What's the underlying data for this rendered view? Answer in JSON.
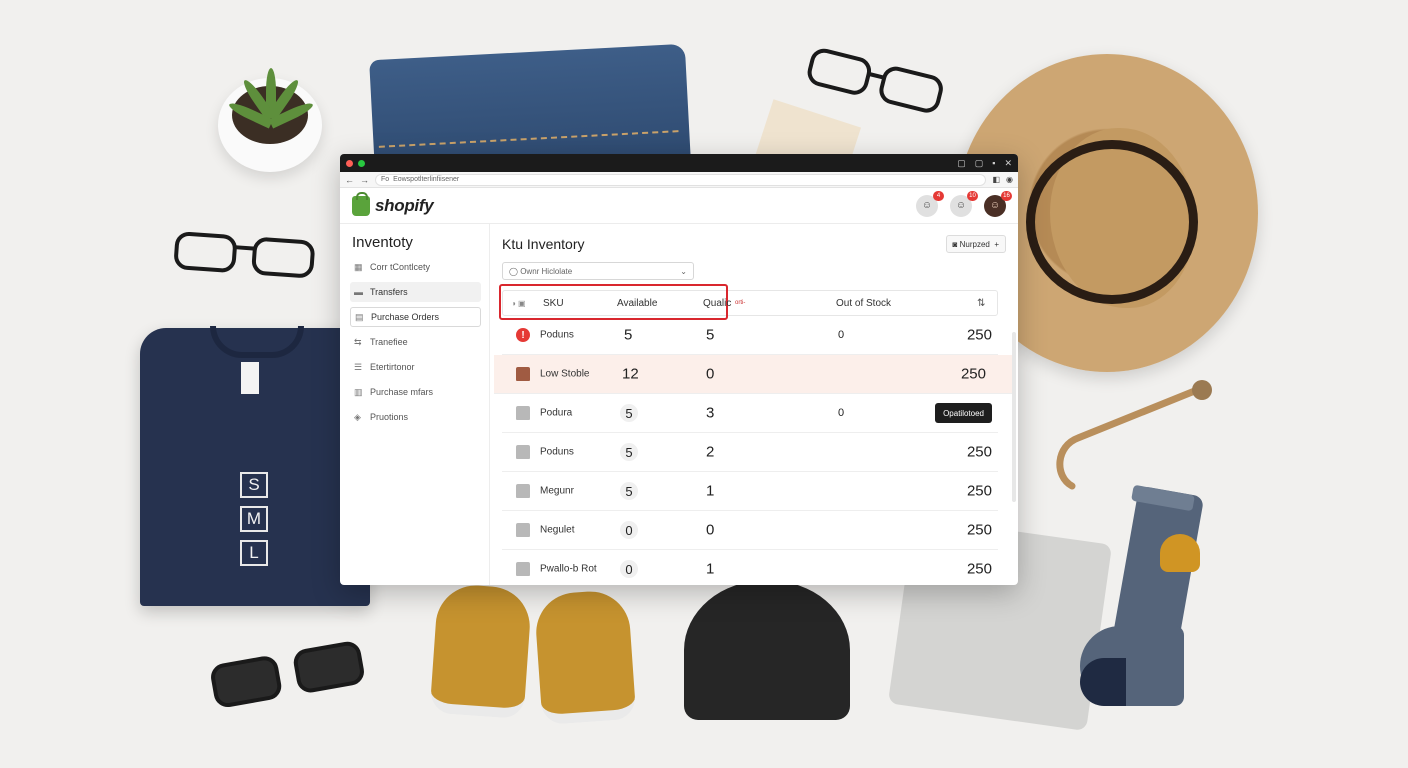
{
  "browser": {
    "url": "Eowspotlterlinfiisener",
    "url_prefix": "Fo"
  },
  "brand": {
    "name": "shopify"
  },
  "header": {
    "avatars": [
      {
        "badge": "4"
      },
      {
        "badge": "10"
      },
      {
        "badge": "16"
      }
    ]
  },
  "sidebar": {
    "title": "Inventoty",
    "items": [
      {
        "label": "Corr tContlcety",
        "icon": "grid-icon"
      },
      {
        "label": "Transfers",
        "icon": "tray-icon"
      },
      {
        "label": "Purchase Orders",
        "icon": "clipboard-icon"
      },
      {
        "label": "Tranefiee",
        "icon": "swap-icon"
      },
      {
        "label": "Etertirtonor",
        "icon": "list-icon"
      },
      {
        "label": "Purchase mfars",
        "icon": "document-icon"
      },
      {
        "label": "Pruotions",
        "icon": "tag-icon"
      }
    ]
  },
  "main": {
    "title": "Ktu Inventory",
    "header_button": "Nurpzed",
    "filter_placeholder": "Ownr Hiclolate"
  },
  "table": {
    "columns": {
      "sku": "SKU",
      "available": "Available",
      "quality": "Qualic",
      "quality_extra": "orti-",
      "out_of_stock": "Out of Stock"
    },
    "rows": [
      {
        "name": "Poduns",
        "available": "5",
        "quality": "5",
        "out_of_stock": "0",
        "total": "250",
        "icon": "alert-icon",
        "state": "alert"
      },
      {
        "name": "Low Stoble",
        "available": "12",
        "quality": "0",
        "out_of_stock": "",
        "total": "250",
        "icon": "box-icon",
        "state": "warning"
      },
      {
        "name": "Podura",
        "available": "5",
        "quality": "3",
        "out_of_stock": "0",
        "total": "",
        "action": "Opatilotoed",
        "icon": "box-icon",
        "state": "normal"
      },
      {
        "name": "Poduns",
        "available": "5",
        "quality": "2",
        "out_of_stock": "",
        "total": "250",
        "icon": "box-icon",
        "state": "normal"
      },
      {
        "name": "Megunr",
        "available": "5",
        "quality": "1",
        "out_of_stock": "",
        "total": "250",
        "icon": "box-icon",
        "state": "normal"
      },
      {
        "name": "Negulet",
        "available": "0",
        "quality": "0",
        "out_of_stock": "",
        "total": "250",
        "icon": "box-icon",
        "state": "normal"
      },
      {
        "name": "Pwallo-b Rot",
        "available": "0",
        "quality": "1",
        "out_of_stock": "",
        "total": "250",
        "icon": "box-icon",
        "state": "normal"
      }
    ]
  },
  "decor": {
    "shirt_sizes": [
      "S",
      "M",
      "L"
    ]
  },
  "colors": {
    "brand_green": "#5aa33b",
    "alert_red": "#e53935",
    "highlight_red": "#d9272e",
    "warning_row": "#fcefea"
  }
}
